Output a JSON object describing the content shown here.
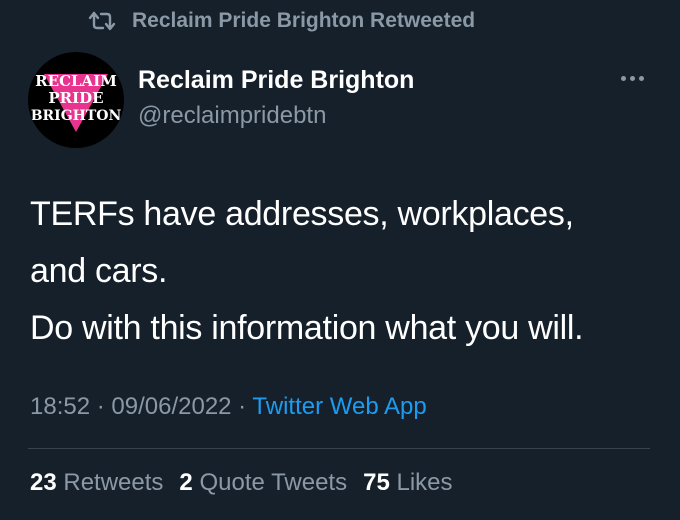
{
  "banner": {
    "icon": "retweet-icon",
    "text": "Reclaim Pride Brighton Retweeted"
  },
  "author": {
    "avatar_text": [
      "RECLAIM",
      "PRIDE",
      "BRIGHTON"
    ],
    "display_name": "Reclaim Pride Brighton",
    "handle": "@reclaimpridebtn"
  },
  "more_icon": "more-options-icon",
  "tweet": {
    "lines": [
      "TERFs have addresses, workplaces,",
      "and cars.",
      "Do with this information what you will."
    ]
  },
  "meta": {
    "time": "18:52",
    "separator": " · ",
    "date": "09/06/2022",
    "source": "Twitter Web App"
  },
  "stats": {
    "retweets_count": "23",
    "retweets_label": "Retweets",
    "quotes_count": "2",
    "quotes_label": "Quote Tweets",
    "likes_count": "75",
    "likes_label": "Likes"
  },
  "colors": {
    "background": "#15202b",
    "secondary_text": "#8b98a5",
    "link": "#1d9bf0",
    "avatar_triangle": "#e8348f"
  }
}
